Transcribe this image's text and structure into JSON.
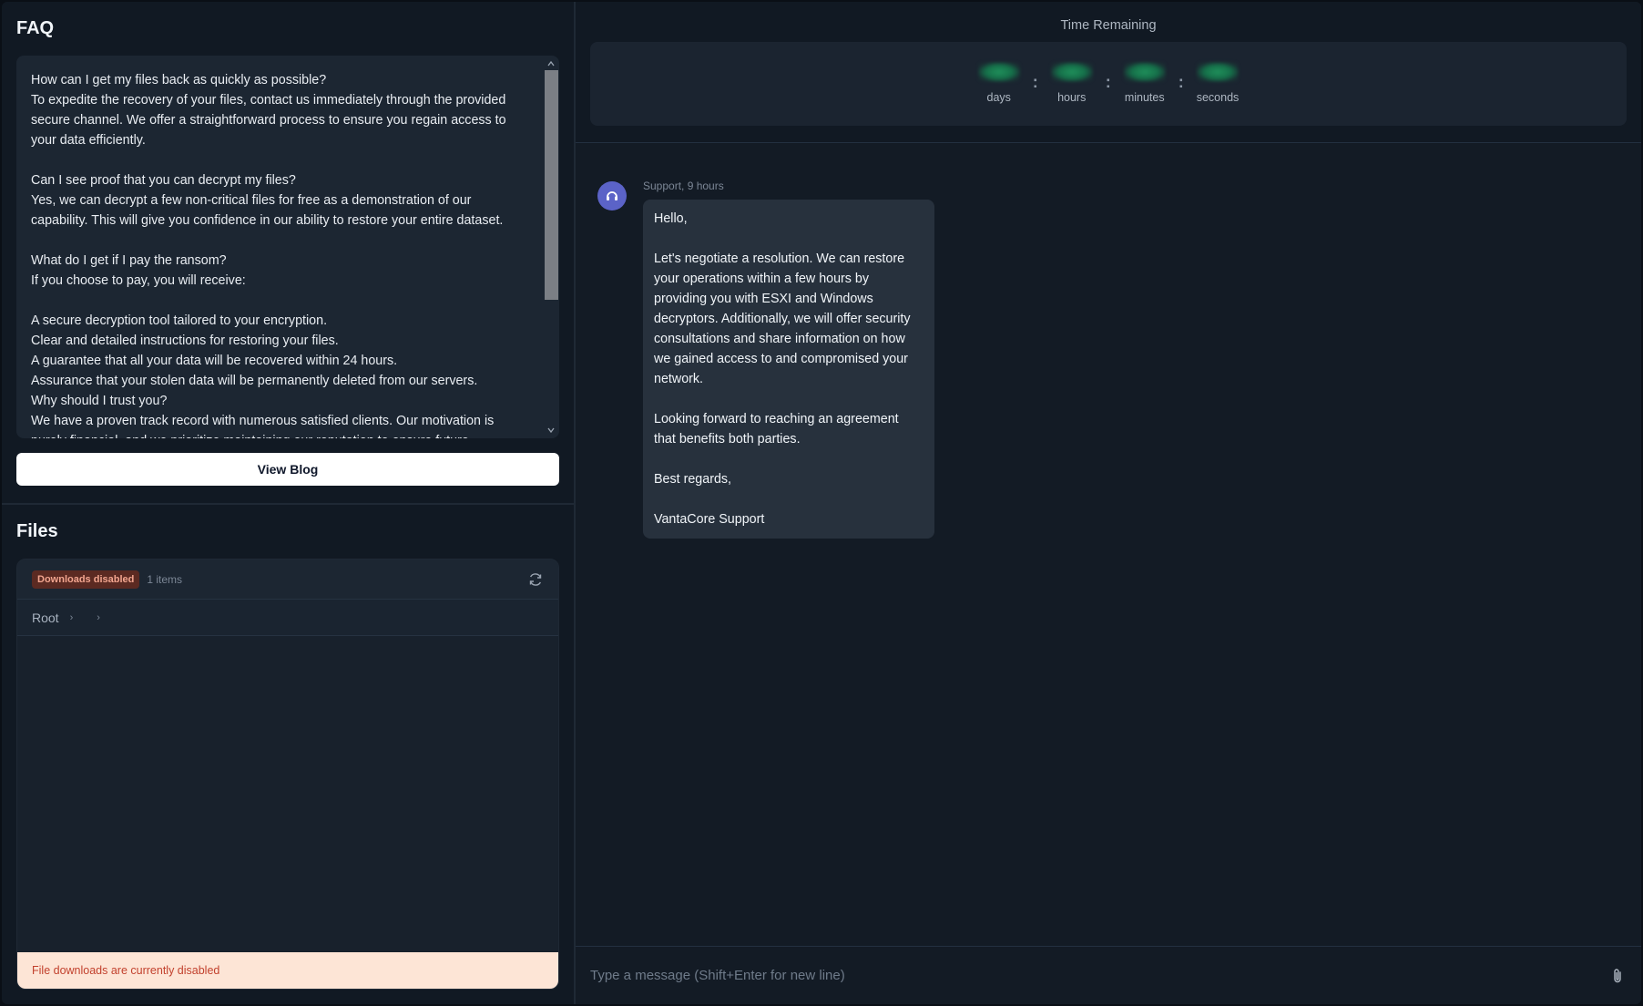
{
  "faq": {
    "title": "FAQ",
    "text": "How can I get my files back as quickly as possible?\nTo expedite the recovery of your files, contact us immediately through the provided secure channel. We offer a straightforward process to ensure you regain access to your data efficiently.\n\nCan I see proof that you can decrypt my files?\nYes, we can decrypt a few non-critical files for free as a demonstration of our capability. This will give you confidence in our ability to restore your entire dataset.\n\nWhat do I get if I pay the ransom?\nIf you choose to pay, you will receive:\n\nA secure decryption tool tailored to your encryption.\nClear and detailed instructions for restoring your files.\nA guarantee that all your data will be recovered within 24 hours.\nAssurance that your stolen data will be permanently deleted from our servers.\nWhy should I trust you?\nWe have a proven track record with numerous satisfied clients. Our motivation is purely financial, and we prioritize maintaining our reputation to ensure future",
    "view_blog_label": "View Blog"
  },
  "files": {
    "title": "Files",
    "badge": "Downloads disabled",
    "items_count": "1 items",
    "breadcrumb_root": "Root",
    "breadcrumb_sep": "›",
    "notice": "File downloads are currently disabled"
  },
  "timer": {
    "title": "Time Remaining",
    "units": [
      {
        "label": "days"
      },
      {
        "label": "hours"
      },
      {
        "label": "minutes"
      },
      {
        "label": "seconds"
      }
    ],
    "separator": ":"
  },
  "chat": {
    "messages": [
      {
        "sender": "Support",
        "time": "9 hours",
        "meta": "Support, 9 hours",
        "text": "Hello,\n\nLet's negotiate a resolution. We can restore your operations within a few hours by providing you with ESXI and Windows decryptors. Additionally, we will offer security consultations and share information on how we gained access to and compromised your network.\n\nLooking forward to reaching an agreement that benefits both parties.\n\nBest regards,\n\nVantaCore Support"
      }
    ],
    "composer_placeholder": "Type a message (Shift+Enter for new line)"
  },
  "colors": {
    "accent": "#5b63c7",
    "badge_bg": "#5b2a22",
    "notice_bg": "#fde5d6",
    "notice_text": "#c2412d"
  }
}
